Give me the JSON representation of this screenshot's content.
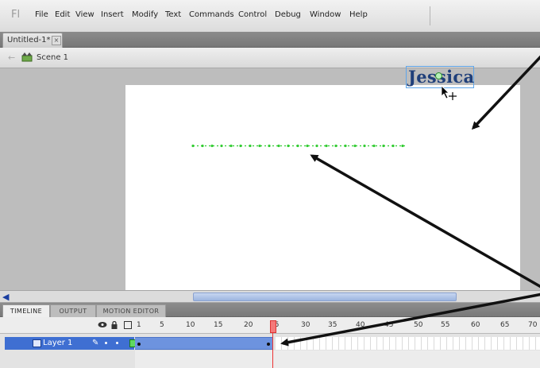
{
  "menubar": {
    "app_logo": "Fl",
    "items": [
      "File",
      "Edit",
      "View",
      "Insert",
      "Modify",
      "Text",
      "Commands",
      "Control",
      "Debug",
      "Window",
      "Help"
    ]
  },
  "document": {
    "tab_label": "Untitled-1*",
    "tab_close": "×"
  },
  "scene": {
    "label": "Scene 1"
  },
  "stage": {
    "text": "Jessica"
  },
  "panel_tabs": [
    "TIMELINE",
    "OUTPUT",
    "MOTION EDITOR"
  ],
  "timeline": {
    "frame_numbers": [
      "1",
      "5",
      "10",
      "15",
      "20",
      "25",
      "30",
      "35",
      "40",
      "45",
      "50",
      "55",
      "60",
      "65",
      "70"
    ],
    "current_frame": 25,
    "layer": {
      "name": "Layer 1",
      "tween_start_frame": 1,
      "tween_end_frame": 25
    }
  },
  "colors": {
    "motion_guide": "#33cc33",
    "tween_fill": "#6d93df",
    "playhead": "#ee3333",
    "text": "#1f3f7a",
    "annotation_arrow": "#111111"
  }
}
